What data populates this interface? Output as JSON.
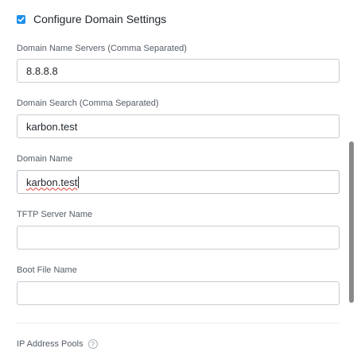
{
  "configure": {
    "label": "Configure Domain Settings",
    "checked": true
  },
  "fields": [
    {
      "label": "Domain Name Servers (Comma Separated)",
      "value": "8.8.8.8"
    },
    {
      "label": "Domain Search (Comma Separated)",
      "value": "karbon.test"
    },
    {
      "label": "Domain Name",
      "value": "karbon.test"
    },
    {
      "label": "TFTP Server Name",
      "value": ""
    },
    {
      "label": "Boot File Name",
      "value": ""
    }
  ],
  "pools": {
    "label": "IP Address Pools",
    "help_icon": "?"
  },
  "colors": {
    "accent": "#1e8fe8",
    "border": "#c7ccd1",
    "scrollbar": "#898989"
  }
}
